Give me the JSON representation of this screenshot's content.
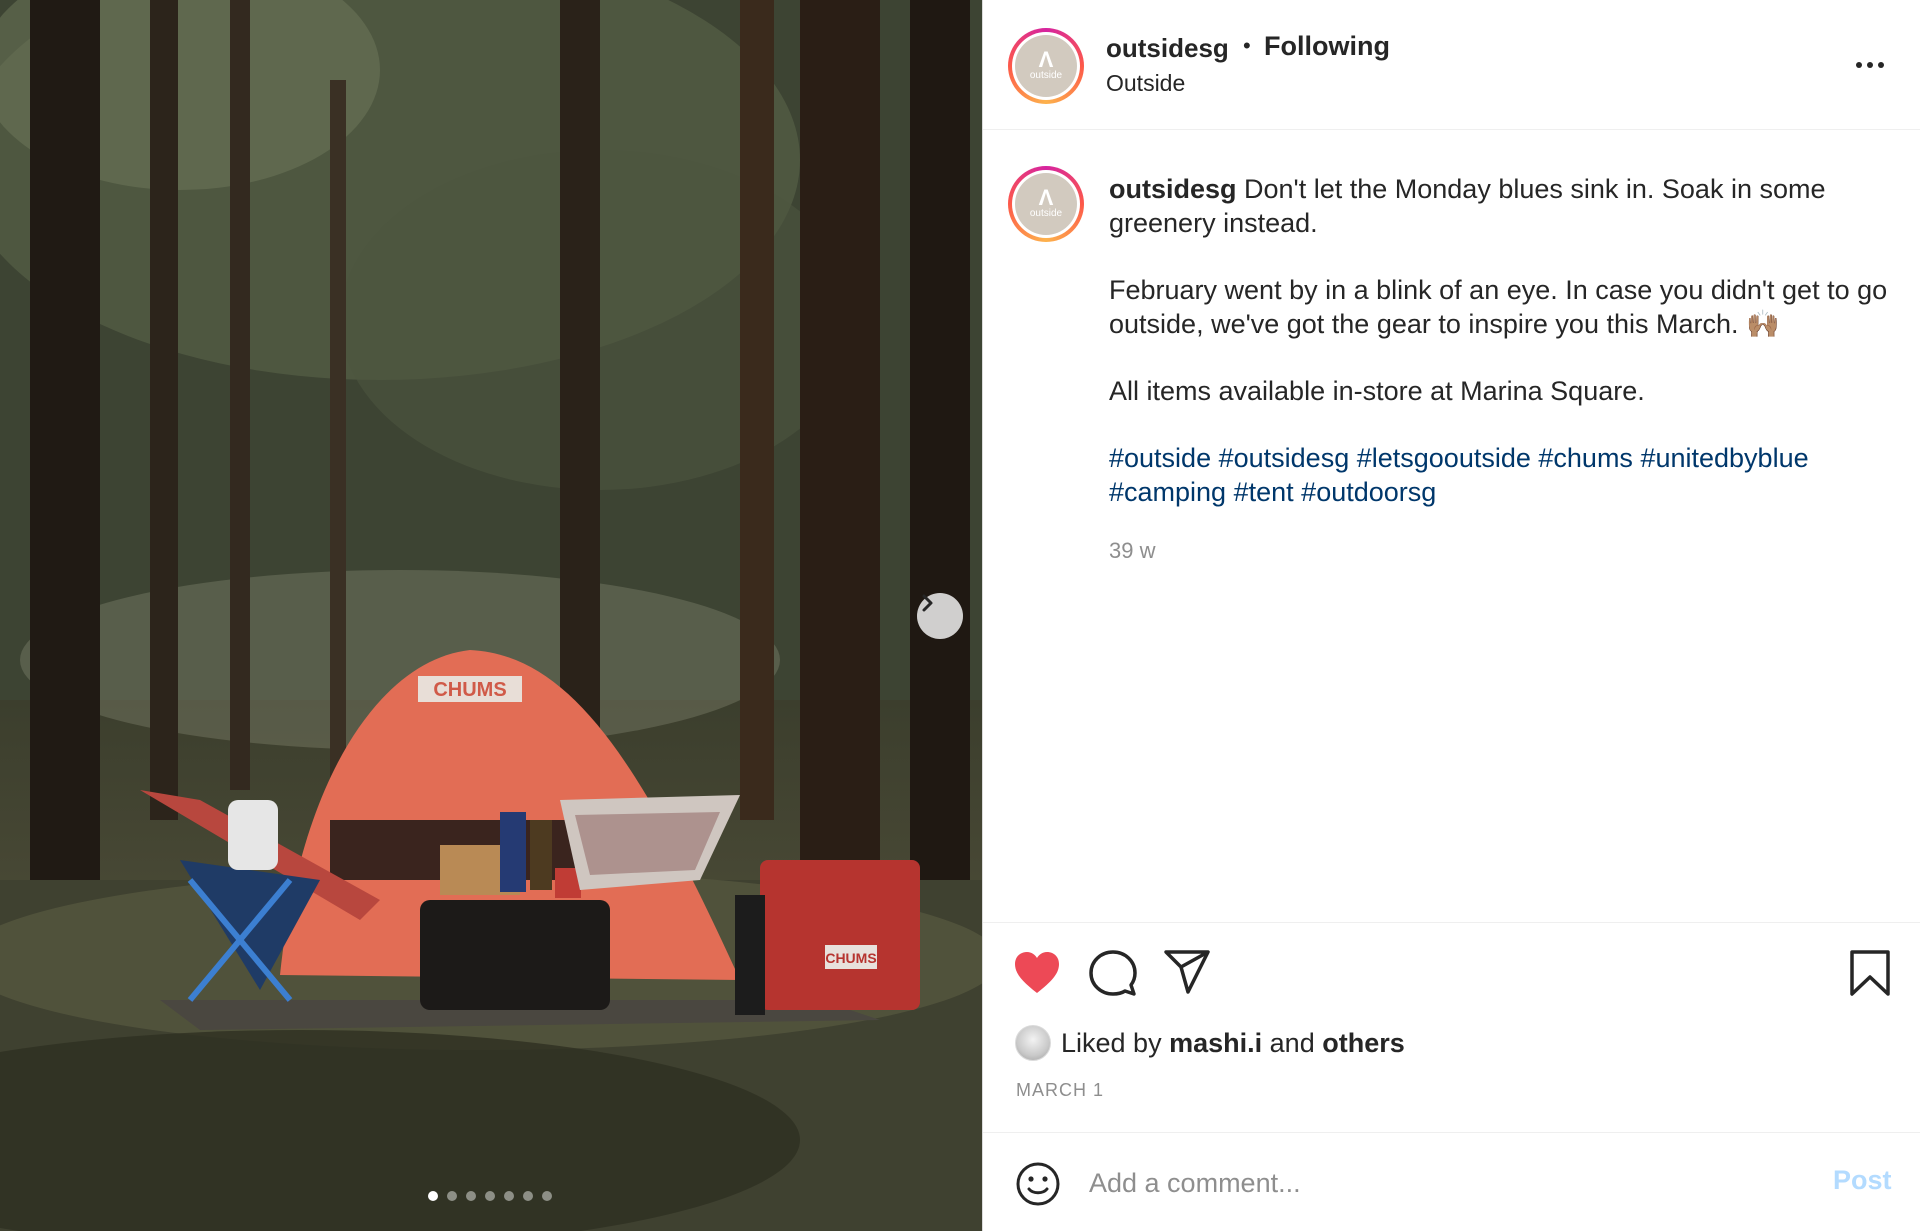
{
  "post": {
    "username": "outsidesg",
    "separator": "•",
    "follow_state": "Following",
    "location": "Outside",
    "avatar_mark": "Λ",
    "avatar_word": "outside",
    "more_icon": "more-horizontal-icon"
  },
  "photo": {
    "brand_tent": "CHUMS",
    "brand_bag": "CHUMS",
    "slide_count": 7,
    "active_slide": 1,
    "next_icon": "chevron-right-icon"
  },
  "caption": {
    "username": "outsidesg",
    "line1": "Don't let the Monday blues sink in. Soak in some greenery instead.",
    "line2": "February went by in a blink of an eye. In case you didn't get to go outside, we've got the gear to inspire you this March. 🙌🏽",
    "line3": "All items available in-store at Marina Square.",
    "hashtags": [
      "#outside",
      "#outsidesg",
      "#letsgooutside",
      "#chums",
      "#unitedbyblue",
      "#camping",
      "#tent",
      "#outdoorsg"
    ],
    "time_ago": "39 w"
  },
  "actions": {
    "like_icon": "heart-filled-icon",
    "comment_icon": "comment-icon",
    "share_icon": "share-icon",
    "save_icon": "bookmark-icon",
    "like_color": "#ed4956",
    "liked_prefix": "Liked by",
    "liked_user": "mashi.i",
    "liked_and": "and",
    "liked_others": "others",
    "date": "MARCH 1"
  },
  "comment": {
    "emoji_icon": "emoji-icon",
    "placeholder": "Add a comment...",
    "post_label": "Post"
  }
}
